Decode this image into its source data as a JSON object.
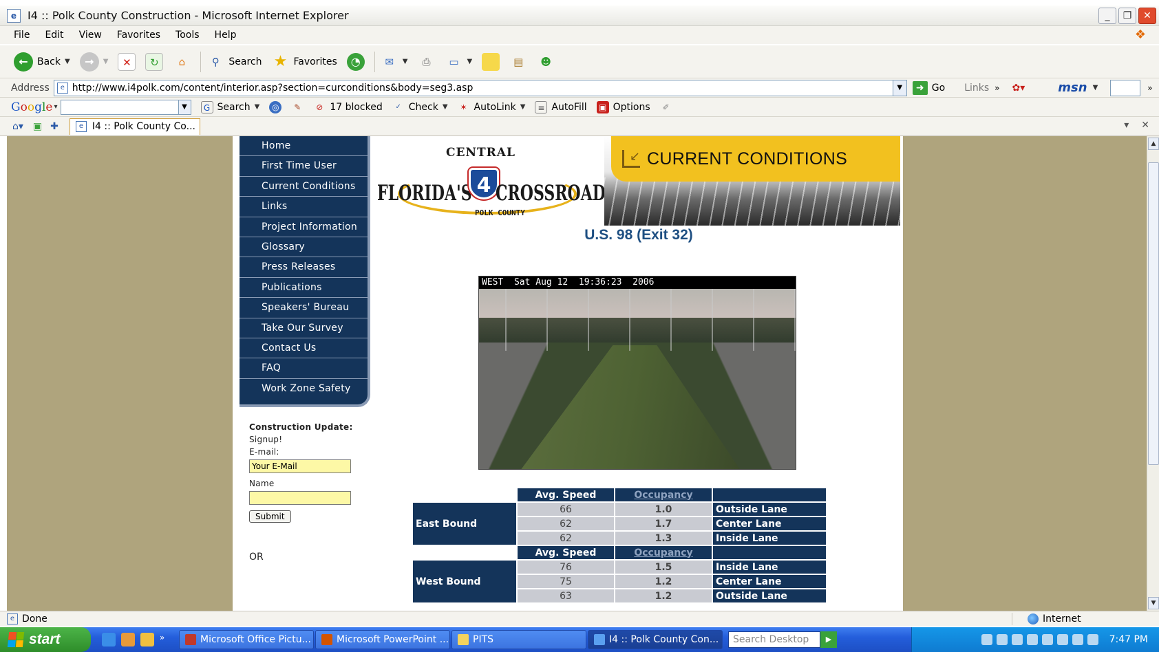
{
  "window": {
    "title": "I4 :: Polk County Construction - Microsoft Internet Explorer",
    "buttons": [
      "_",
      "❐",
      "✕"
    ]
  },
  "menu": [
    "File",
    "Edit",
    "View",
    "Favorites",
    "Tools",
    "Help"
  ],
  "toolbar": {
    "back_label": "Back",
    "search_label": "Search",
    "favorites_label": "Favorites"
  },
  "address": {
    "label": "Address",
    "url": "http://www.i4polk.com/content/interior.asp?section=curconditions&body=seg3.asp",
    "go_label": "Go",
    "links_label": "Links",
    "msn_label": "msn"
  },
  "googlebar": {
    "search_label": "Search",
    "blocked_label": "17 blocked",
    "check_label": "Check",
    "autolink_label": "AutoLink",
    "autofill_label": "AutoFill",
    "options_label": "Options"
  },
  "tab": {
    "label": "I4 :: Polk County Co..."
  },
  "site": {
    "nav": [
      "Home",
      "First Time User",
      "Current Conditions",
      "Links",
      "Project Information",
      "Glossary",
      "Press Releases",
      "Publications",
      "Speakers' Bureau",
      "Take Our Survey",
      "Contact Us",
      "FAQ",
      "Work Zone Safety"
    ],
    "logo": {
      "central": "CENTRAL",
      "florida": "FLORIDA'S",
      "interstate": "4",
      "crossroad": "CROSSROAD",
      "county": "POLK COUNTY"
    },
    "banner": "CURRENT CONDITIONS",
    "exit_title": "U.S. 98 (Exit 32)",
    "camera_stamp": "WEST  Sat Aug 12  19:36:23  2006",
    "signup": {
      "heading": "Construction Update:",
      "signup": "Signup!",
      "email_label": "E-mail:",
      "email_value": "Your E-Mail",
      "name_label": "Name",
      "submit_label": "Submit",
      "or_label": "OR"
    },
    "traffic": {
      "col_speed": "Avg. Speed",
      "col_occupancy": "Occupancy",
      "east": {
        "label": "East Bound",
        "rows": [
          {
            "speed": "66",
            "occupancy": "1.0",
            "lane": "Outside Lane"
          },
          {
            "speed": "62",
            "occupancy": "1.7",
            "lane": "Center Lane"
          },
          {
            "speed": "62",
            "occupancy": "1.3",
            "lane": "Inside Lane"
          }
        ]
      },
      "west": {
        "label": "West Bound",
        "rows": [
          {
            "speed": "76",
            "occupancy": "1.5",
            "lane": "Inside Lane"
          },
          {
            "speed": "75",
            "occupancy": "1.2",
            "lane": "Center Lane"
          },
          {
            "speed": "63",
            "occupancy": "1.2",
            "lane": "Outside Lane"
          }
        ]
      }
    }
  },
  "status": {
    "text": "Done",
    "zone": "Internet"
  },
  "taskbar": {
    "start_label": "start",
    "tasks": [
      "Microsoft Office Pictu...",
      "Microsoft PowerPoint ...",
      "PITS",
      "I4 :: Polk County Con..."
    ],
    "search_placeholder": "Search Desktop",
    "clock": "7:47 PM"
  },
  "colors": {
    "nav_bg": "#14345a",
    "banner_yellow": "#f2c11f",
    "page_bg": "#afa47d",
    "title_blue": "#1e4f82"
  }
}
